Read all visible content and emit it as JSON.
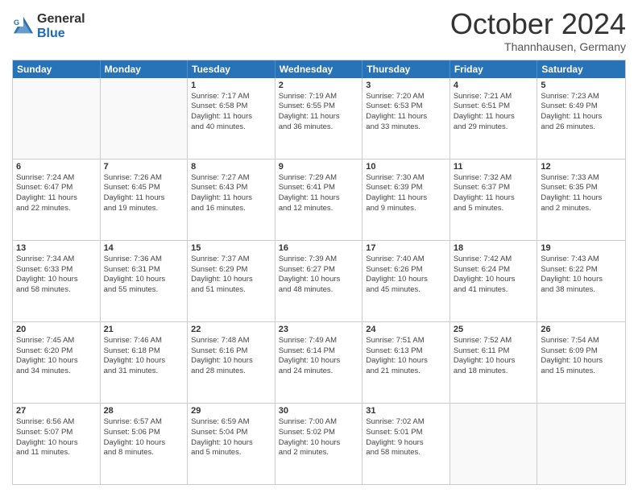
{
  "logo": {
    "general": "General",
    "blue": "Blue"
  },
  "title": "October 2024",
  "subtitle": "Thannhausen, Germany",
  "days": [
    "Sunday",
    "Monday",
    "Tuesday",
    "Wednesday",
    "Thursday",
    "Friday",
    "Saturday"
  ],
  "rows": [
    [
      {
        "day": "",
        "lines": []
      },
      {
        "day": "",
        "lines": []
      },
      {
        "day": "1",
        "lines": [
          "Sunrise: 7:17 AM",
          "Sunset: 6:58 PM",
          "Daylight: 11 hours",
          "and 40 minutes."
        ]
      },
      {
        "day": "2",
        "lines": [
          "Sunrise: 7:19 AM",
          "Sunset: 6:55 PM",
          "Daylight: 11 hours",
          "and 36 minutes."
        ]
      },
      {
        "day": "3",
        "lines": [
          "Sunrise: 7:20 AM",
          "Sunset: 6:53 PM",
          "Daylight: 11 hours",
          "and 33 minutes."
        ]
      },
      {
        "day": "4",
        "lines": [
          "Sunrise: 7:21 AM",
          "Sunset: 6:51 PM",
          "Daylight: 11 hours",
          "and 29 minutes."
        ]
      },
      {
        "day": "5",
        "lines": [
          "Sunrise: 7:23 AM",
          "Sunset: 6:49 PM",
          "Daylight: 11 hours",
          "and 26 minutes."
        ]
      }
    ],
    [
      {
        "day": "6",
        "lines": [
          "Sunrise: 7:24 AM",
          "Sunset: 6:47 PM",
          "Daylight: 11 hours",
          "and 22 minutes."
        ]
      },
      {
        "day": "7",
        "lines": [
          "Sunrise: 7:26 AM",
          "Sunset: 6:45 PM",
          "Daylight: 11 hours",
          "and 19 minutes."
        ]
      },
      {
        "day": "8",
        "lines": [
          "Sunrise: 7:27 AM",
          "Sunset: 6:43 PM",
          "Daylight: 11 hours",
          "and 16 minutes."
        ]
      },
      {
        "day": "9",
        "lines": [
          "Sunrise: 7:29 AM",
          "Sunset: 6:41 PM",
          "Daylight: 11 hours",
          "and 12 minutes."
        ]
      },
      {
        "day": "10",
        "lines": [
          "Sunrise: 7:30 AM",
          "Sunset: 6:39 PM",
          "Daylight: 11 hours",
          "and 9 minutes."
        ]
      },
      {
        "day": "11",
        "lines": [
          "Sunrise: 7:32 AM",
          "Sunset: 6:37 PM",
          "Daylight: 11 hours",
          "and 5 minutes."
        ]
      },
      {
        "day": "12",
        "lines": [
          "Sunrise: 7:33 AM",
          "Sunset: 6:35 PM",
          "Daylight: 11 hours",
          "and 2 minutes."
        ]
      }
    ],
    [
      {
        "day": "13",
        "lines": [
          "Sunrise: 7:34 AM",
          "Sunset: 6:33 PM",
          "Daylight: 10 hours",
          "and 58 minutes."
        ]
      },
      {
        "day": "14",
        "lines": [
          "Sunrise: 7:36 AM",
          "Sunset: 6:31 PM",
          "Daylight: 10 hours",
          "and 55 minutes."
        ]
      },
      {
        "day": "15",
        "lines": [
          "Sunrise: 7:37 AM",
          "Sunset: 6:29 PM",
          "Daylight: 10 hours",
          "and 51 minutes."
        ]
      },
      {
        "day": "16",
        "lines": [
          "Sunrise: 7:39 AM",
          "Sunset: 6:27 PM",
          "Daylight: 10 hours",
          "and 48 minutes."
        ]
      },
      {
        "day": "17",
        "lines": [
          "Sunrise: 7:40 AM",
          "Sunset: 6:26 PM",
          "Daylight: 10 hours",
          "and 45 minutes."
        ]
      },
      {
        "day": "18",
        "lines": [
          "Sunrise: 7:42 AM",
          "Sunset: 6:24 PM",
          "Daylight: 10 hours",
          "and 41 minutes."
        ]
      },
      {
        "day": "19",
        "lines": [
          "Sunrise: 7:43 AM",
          "Sunset: 6:22 PM",
          "Daylight: 10 hours",
          "and 38 minutes."
        ]
      }
    ],
    [
      {
        "day": "20",
        "lines": [
          "Sunrise: 7:45 AM",
          "Sunset: 6:20 PM",
          "Daylight: 10 hours",
          "and 34 minutes."
        ]
      },
      {
        "day": "21",
        "lines": [
          "Sunrise: 7:46 AM",
          "Sunset: 6:18 PM",
          "Daylight: 10 hours",
          "and 31 minutes."
        ]
      },
      {
        "day": "22",
        "lines": [
          "Sunrise: 7:48 AM",
          "Sunset: 6:16 PM",
          "Daylight: 10 hours",
          "and 28 minutes."
        ]
      },
      {
        "day": "23",
        "lines": [
          "Sunrise: 7:49 AM",
          "Sunset: 6:14 PM",
          "Daylight: 10 hours",
          "and 24 minutes."
        ]
      },
      {
        "day": "24",
        "lines": [
          "Sunrise: 7:51 AM",
          "Sunset: 6:13 PM",
          "Daylight: 10 hours",
          "and 21 minutes."
        ]
      },
      {
        "day": "25",
        "lines": [
          "Sunrise: 7:52 AM",
          "Sunset: 6:11 PM",
          "Daylight: 10 hours",
          "and 18 minutes."
        ]
      },
      {
        "day": "26",
        "lines": [
          "Sunrise: 7:54 AM",
          "Sunset: 6:09 PM",
          "Daylight: 10 hours",
          "and 15 minutes."
        ]
      }
    ],
    [
      {
        "day": "27",
        "lines": [
          "Sunrise: 6:56 AM",
          "Sunset: 5:07 PM",
          "Daylight: 10 hours",
          "and 11 minutes."
        ]
      },
      {
        "day": "28",
        "lines": [
          "Sunrise: 6:57 AM",
          "Sunset: 5:06 PM",
          "Daylight: 10 hours",
          "and 8 minutes."
        ]
      },
      {
        "day": "29",
        "lines": [
          "Sunrise: 6:59 AM",
          "Sunset: 5:04 PM",
          "Daylight: 10 hours",
          "and 5 minutes."
        ]
      },
      {
        "day": "30",
        "lines": [
          "Sunrise: 7:00 AM",
          "Sunset: 5:02 PM",
          "Daylight: 10 hours",
          "and 2 minutes."
        ]
      },
      {
        "day": "31",
        "lines": [
          "Sunrise: 7:02 AM",
          "Sunset: 5:01 PM",
          "Daylight: 9 hours",
          "and 58 minutes."
        ]
      },
      {
        "day": "",
        "lines": []
      },
      {
        "day": "",
        "lines": []
      }
    ]
  ]
}
